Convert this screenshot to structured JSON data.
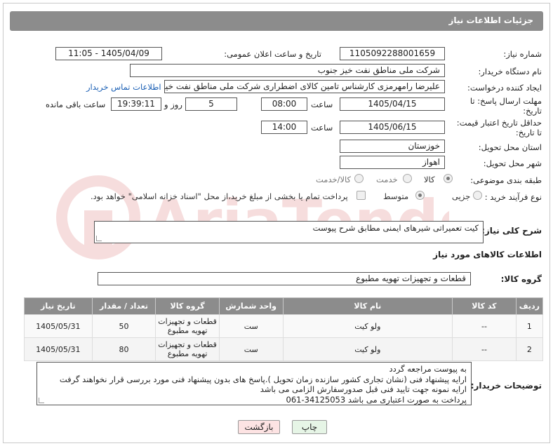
{
  "header": {
    "title": "جزئیات اطلاعات نیاز"
  },
  "form": {
    "need_number_label": "شماره نیاز:",
    "need_number": "1105092288001659",
    "announce_label": "تاریخ و ساعت اعلان عمومی:",
    "announce_value": "1405/04/09 - 11:05",
    "buyer_org_label": "نام دستگاه خریدار:",
    "buyer_org": "شرکت ملی مناطق نفت خیز جنوب",
    "creator_label": "ایجاد کننده درخواست:",
    "creator": "علیرضا رامهرمزی کارشناس تامین کالای اضطراری شرکت ملی مناطق نفت خیز جنوب",
    "contact_link": "اطلاعات تماس خریدار",
    "reply_deadline_label_1": "مهلت ارسال پاسخ: تا",
    "reply_deadline_label_2": "تاریخ:",
    "reply_date": "1405/04/15",
    "time_label": "ساعت",
    "reply_time": "08:00",
    "days_value": "5",
    "days_label": "روز و",
    "remaining_time": "19:39:11",
    "remaining_label": "ساعت باقی مانده",
    "price_deadline_label_1": "حداقل تاریخ اعتبار قیمت:",
    "price_deadline_label_2": "تا تاریخ:",
    "price_date": "1405/06/15",
    "price_time": "14:00",
    "province_label": "استان محل تحویل:",
    "province": "خوزستان",
    "city_label": "شهر محل تحویل:",
    "city": "اهواز",
    "category_label": "طبقه بندی موضوعی:",
    "category_options": [
      "کالا",
      "خدمت",
      "کالا/خدمت"
    ],
    "purchase_type_label": "نوع فرآیند خرید :",
    "purchase_options": [
      "جزیی",
      "متوسط"
    ],
    "payment_note": "پرداخت تمام یا بخشی از مبلغ خرید،از محل \"اسناد خزانه اسلامی\" خواهد بود.",
    "summary_label": "شرح کلی نیاز:",
    "summary": "کیت تعمیراتی شیرهای ایمنی مطابق شرح پیوست",
    "goods_info_title": "اطلاعات کالاهای مورد نیاز",
    "goods_group_label": "گروه کالا:",
    "goods_group": "قطعات و تجهیزات تهویه مطبوع"
  },
  "table": {
    "headers": [
      "ردیف",
      "کد کالا",
      "نام کالا",
      "واحد شمارش",
      "گروه کالا",
      "تعداد / مقدار",
      "تاریخ نیاز"
    ],
    "rows": [
      [
        "1",
        "--",
        "ولو کیت",
        "ست",
        "قطعات و تجهیزات تهویه مطبوع",
        "50",
        "1405/05/31"
      ],
      [
        "2",
        "--",
        "ولو کیت",
        "ست",
        "قطعات و تجهیزات تهویه مطبوع",
        "80",
        "1405/05/31"
      ]
    ]
  },
  "buyer_notes": {
    "label": "توضیحات خریدار:",
    "lines": [
      "به پیوست مراجعه گردد",
      "ارایه پیشنهاد فنی (نشان تجاری کشور سازنده زمان تحویل ).پاسخ های بدون پیشنهاد فنی مورد بررسی قرار نخواهند گرفت",
      "ارایه نمونه جهت تایید فنی قبل صدورسفارش الزامی می باشد",
      "پرداخت به صورت اعتباری می باشد 34125053-061"
    ]
  },
  "buttons": {
    "print": "چاپ",
    "back": "بازگشت"
  },
  "colors": {
    "header_bg": "#8c8c8c",
    "link": "#1a5fb4",
    "back_button_bg": "#fde3e3",
    "print_button_bg": "#e6f5e6"
  },
  "watermark": "AriaTender.net"
}
